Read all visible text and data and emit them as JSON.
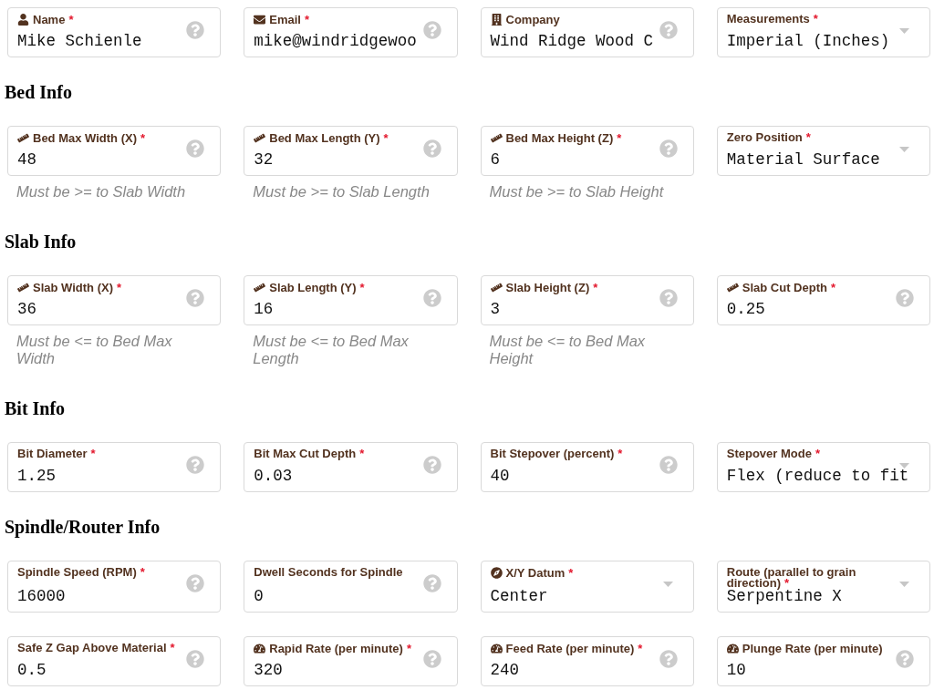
{
  "contact": {
    "fields": [
      {
        "kind": "input",
        "label": "Name",
        "required_mark": "*",
        "value": "Mike Schienle"
      },
      {
        "kind": "input",
        "label": "Email",
        "required_mark": "*",
        "value": "mike@windridgewoo"
      },
      {
        "kind": "input",
        "label": "Company",
        "value": "Wind Ridge Wood C"
      },
      {
        "kind": "select",
        "label": "Measurements",
        "required_mark": "*",
        "value": "Imperial (Inches)"
      }
    ]
  },
  "sections": [
    {
      "heading": "Bed Info",
      "fields": [
        {
          "kind": "input",
          "label": "Bed Max Width (X)",
          "required_mark": "*",
          "value": "48",
          "hint": "Must be >= to Slab Width"
        },
        {
          "kind": "input",
          "label": "Bed Max Length (Y)",
          "required_mark": "*",
          "value": "32",
          "hint": "Must be >= to Slab Length"
        },
        {
          "kind": "input",
          "label": "Bed Max Height (Z)",
          "required_mark": "*",
          "value": "6",
          "hint": "Must be >= to Slab Height"
        },
        {
          "kind": "select",
          "label": "Zero Position",
          "required_mark": "*",
          "value": "Material Surface"
        }
      ]
    },
    {
      "heading": "Slab Info",
      "fields": [
        {
          "kind": "input",
          "label": "Slab Width (X)",
          "required_mark": "*",
          "value": "36",
          "hint": "Must be <= to Bed Max Width"
        },
        {
          "kind": "input",
          "label": "Slab Length (Y)",
          "required_mark": "*",
          "value": "16",
          "hint": "Must be <= to Bed Max Length"
        },
        {
          "kind": "input",
          "label": "Slab Height (Z)",
          "required_mark": "*",
          "value": "3",
          "hint": "Must be <= to Bed Max Height"
        },
        {
          "kind": "input",
          "label": "Slab Cut Depth",
          "required_mark": "*",
          "value": "0.25"
        }
      ]
    },
    {
      "heading": "Bit Info",
      "fields": [
        {
          "kind": "input",
          "label": "Bit Diameter",
          "required_mark": "*",
          "value": "1.25"
        },
        {
          "kind": "input",
          "label": "Bit Max Cut Depth",
          "required_mark": "*",
          "value": "0.03"
        },
        {
          "kind": "input",
          "label": "Bit Stepover (percent)",
          "required_mark": "*",
          "value": "40"
        },
        {
          "kind": "select",
          "label": "Stepover Mode",
          "required_mark": "*",
          "value": "Flex (reduce to fit"
        }
      ]
    },
    {
      "heading": "Spindle/Router Info",
      "fields": [
        {
          "kind": "input",
          "label": "Spindle Speed (RPM)",
          "required_mark": "*",
          "value": "16000"
        },
        {
          "kind": "input",
          "label": "Dwell Seconds for Spindle",
          "value": "0"
        },
        {
          "kind": "select",
          "label": "X/Y Datum",
          "required_mark": "*",
          "value": "Center"
        },
        {
          "kind": "select",
          "label": "Route (parallel to grain direction)",
          "required_mark": "*",
          "value": "Serpentine X"
        },
        {
          "kind": "input",
          "label": "Safe Z Gap Above Material",
          "required_mark": "*",
          "value": "0.5"
        },
        {
          "kind": "input",
          "label": "Rapid Rate (per minute)",
          "required_mark": "*",
          "value": "320"
        },
        {
          "kind": "input",
          "label": "Feed Rate (per minute)",
          "required_mark": "*",
          "value": "240"
        },
        {
          "kind": "input",
          "label": "Plunge Rate (per minute)",
          "value": "10"
        }
      ]
    }
  ]
}
